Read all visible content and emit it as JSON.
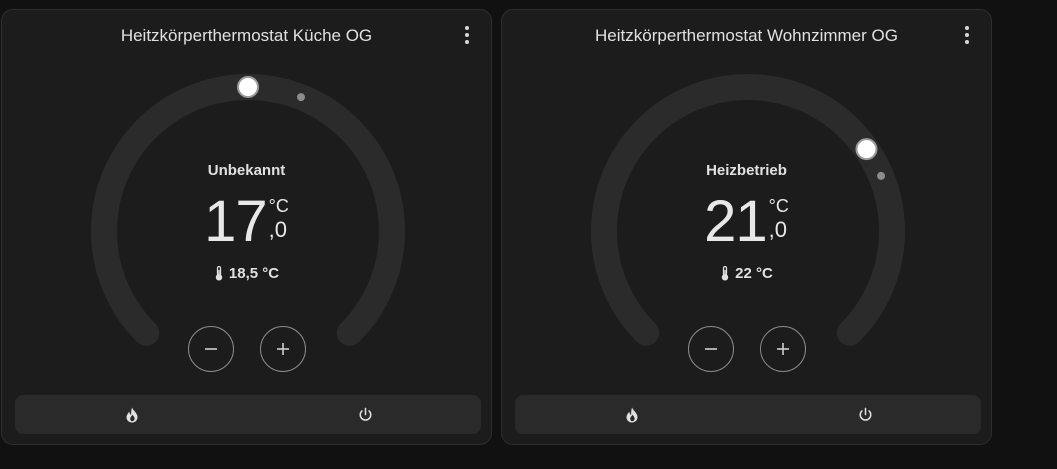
{
  "colors": {
    "background": "#111111",
    "card": "#1c1c1c",
    "track": "#2b2b2b",
    "handle": "#ffffff",
    "text": "#e1e1e1"
  },
  "cards": [
    {
      "title": "Heitzkörperthermostat Küche OG",
      "mode": "Unbekannt",
      "target_integer": "17",
      "target_unit": "°C",
      "target_decimal": ",0",
      "current_temperature": "18,5 °C",
      "setpoint_level": 0.5,
      "current_level": 0.58,
      "icons": {
        "menu": "dots-vertical-icon",
        "thermometer": "thermometer-icon",
        "minus": "minus-icon",
        "plus": "plus-icon",
        "heat": "fire-icon",
        "off": "power-icon"
      }
    },
    {
      "title": "Heitzkörperthermostat Wohnzimmer OG",
      "mode": "Heizbetrieb",
      "target_integer": "21",
      "target_unit": "°C",
      "target_decimal": ",0",
      "current_temperature": "22 °C",
      "setpoint_level": 0.705,
      "current_level": 0.75,
      "icons": {
        "menu": "dots-vertical-icon",
        "thermometer": "thermometer-icon",
        "minus": "minus-icon",
        "plus": "plus-icon",
        "heat": "fire-icon",
        "off": "power-icon"
      }
    }
  ]
}
